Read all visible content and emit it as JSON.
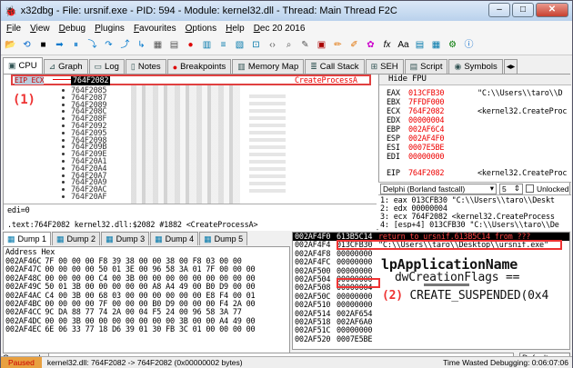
{
  "window": {
    "title": "x32dbg - File: ursnif.exe - PID: 594 - Module: kernel32.dll - Thread: Main Thread F2C"
  },
  "menu": [
    "File",
    "View",
    "Debug",
    "Plugins",
    "Favourites",
    "Options",
    "Help",
    "Dec 20 2016"
  ],
  "tabs": [
    {
      "label": "CPU",
      "icon": "cpu-icon",
      "active": true
    },
    {
      "label": "Graph",
      "icon": "graph-icon"
    },
    {
      "label": "Log",
      "icon": "log-icon"
    },
    {
      "label": "Notes",
      "icon": "notes-icon"
    },
    {
      "label": "Breakpoints",
      "icon": "breakpoint-icon"
    },
    {
      "label": "Memory Map",
      "icon": "memory-icon"
    },
    {
      "label": "Call Stack",
      "icon": "callstack-icon"
    },
    {
      "label": "SEH",
      "icon": "seh-icon"
    },
    {
      "label": "Script",
      "icon": "script-icon"
    },
    {
      "label": "Symbols",
      "icon": "symbols-icon"
    }
  ],
  "disasm": {
    "eip_label": "EIP ECX",
    "eip_addr": "764F2082",
    "eip_api": "CreateProcessA",
    "marker": "(1)",
    "addresses": [
      "764F2085",
      "764F2087",
      "764F2089",
      "764F208C",
      "764F208F",
      "764F2092",
      "764F2095",
      "764F2098",
      "764F209B",
      "764F209E",
      "764F20A1",
      "764F20A4",
      "764F20A7",
      "764F20A9",
      "764F20AC",
      "764F20AF"
    ]
  },
  "registers": {
    "header": "Hide FPU",
    "rows": [
      {
        "name": "EAX",
        "val": "013CFB30",
        "comment": "\"C:\\\\Users\\\\taro\\\\D"
      },
      {
        "name": "EBX",
        "val": "7FFDF000",
        "comment": ""
      },
      {
        "name": "ECX",
        "val": "764F2082",
        "comment": "<kernel32.CreateProc"
      },
      {
        "name": "EDX",
        "val": "00000004",
        "comment": ""
      },
      {
        "name": "EBP",
        "val": "002AF6C4",
        "comment": ""
      },
      {
        "name": "ESP",
        "val": "002AF4F0",
        "comment": ""
      },
      {
        "name": "ESI",
        "val": "0007E5BE",
        "comment": ""
      },
      {
        "name": "EDI",
        "val": "00000000",
        "comment": ""
      },
      {
        "name": "EIP",
        "val": "764F2082",
        "comment": "<kernel32.CreateProc"
      }
    ]
  },
  "callconv": {
    "value": "Delphi (Borland fastcall)",
    "count": "5",
    "unlocked": "Unlocked"
  },
  "args": [
    "1: eax 013CFB30 \"C:\\\\Users\\\\taro\\\\Deskt",
    "2: edx 00000004",
    "3: ecx 764F2082 <kernel32.CreateProcess",
    "4: [esp+4] 013CFB30 \"C:\\\\Users\\\\taro\\\\De"
  ],
  "info": {
    "line1": "edi=0",
    "line2": ".text:764F2082 kernel32.dll:$2082 #1882 <CreateProcessA>"
  },
  "dump_tabs": [
    "Dump 1",
    "Dump 2",
    "Dump 3",
    "Dump 4",
    "Dump 5"
  ],
  "dump": {
    "headers": [
      "Address",
      "Hex"
    ],
    "rows": [
      {
        "a": "002AF46C",
        "h": "7F 00 00 00 F8 39 38 00 00 38 00 F8 03 00 00"
      },
      {
        "a": "002AF47C",
        "h": "00 00 00 00 50 01 3E 00 96 58 3A 01 7F 00 00 00"
      },
      {
        "a": "002AF48C",
        "h": "00 00 00 00 C4 00 3B 00 00 00 00 00 00 00 00 00"
      },
      {
        "a": "002AF49C",
        "h": "50 01 3B 00 00 00 00 00 A8 A4 49 00 B0 D9 00 00"
      },
      {
        "a": "002AF4AC",
        "h": "C4 00 3B 00 68 03 00 00 00 00 00 00 E8 F4 00 01"
      },
      {
        "a": "002AF4BC",
        "h": "00 00 00 00 7F 00 00 00 B0 D9 00 00 00 F4 2A 00"
      },
      {
        "a": "002AF4CC",
        "h": "9C DA 88 77 74 2A 00 04 F5 24 00 96 58 3A 77"
      },
      {
        "a": "002AF4DC",
        "h": "00 00 3B 00 00 00 00 00 00 00 3B 00 00 A4 49 00"
      },
      {
        "a": "002AF4EC",
        "h": "6E 06 33 77 18 D6 39 01 30 FB 3C 01 00 00 00 00"
      }
    ]
  },
  "stack": {
    "rows": [
      {
        "a": "002AF4F0",
        "v": "613B5C14",
        "c": "return to ursnif.613B5C14 from ???"
      },
      {
        "a": "002AF4F4",
        "v": "013CFB30",
        "c": "\"C:\\\\Users\\\\taro\\\\Desktop\\\\ursnif.exe\""
      },
      {
        "a": "002AF4F8",
        "v": "00000000",
        "c": ""
      },
      {
        "a": "002AF4FC",
        "v": "00000000",
        "c": ""
      },
      {
        "a": "002AF500",
        "v": "00000000",
        "c": ""
      },
      {
        "a": "002AF504",
        "v": "00000000",
        "c": ""
      },
      {
        "a": "002AF508",
        "v": "00000004",
        "c": ""
      },
      {
        "a": "002AF50C",
        "v": "00000000",
        "c": ""
      },
      {
        "a": "002AF510",
        "v": "00000000",
        "c": ""
      },
      {
        "a": "002AF514",
        "v": "002AF654",
        "c": ""
      },
      {
        "a": "002AF518",
        "v": "002AF6A0",
        "c": ""
      },
      {
        "a": "002AF51C",
        "v": "00000000",
        "c": ""
      },
      {
        "a": "002AF520",
        "v": "0007E5BE",
        "c": ""
      }
    ],
    "annotation_name": "lpApplicationName",
    "annotation_flags": "dwCreationFlags ==",
    "annotation_num": "(2)",
    "annotation_value": "CREATE_SUSPENDED(0x4"
  },
  "command": {
    "label": "Command:",
    "default": "Default"
  },
  "status": {
    "state": "Paused",
    "text": "kernel32.dll: 764F2082 -> 764F2082 (0x00000002 bytes)",
    "time": "Time Wasted Debugging: 0:06:07:06"
  }
}
